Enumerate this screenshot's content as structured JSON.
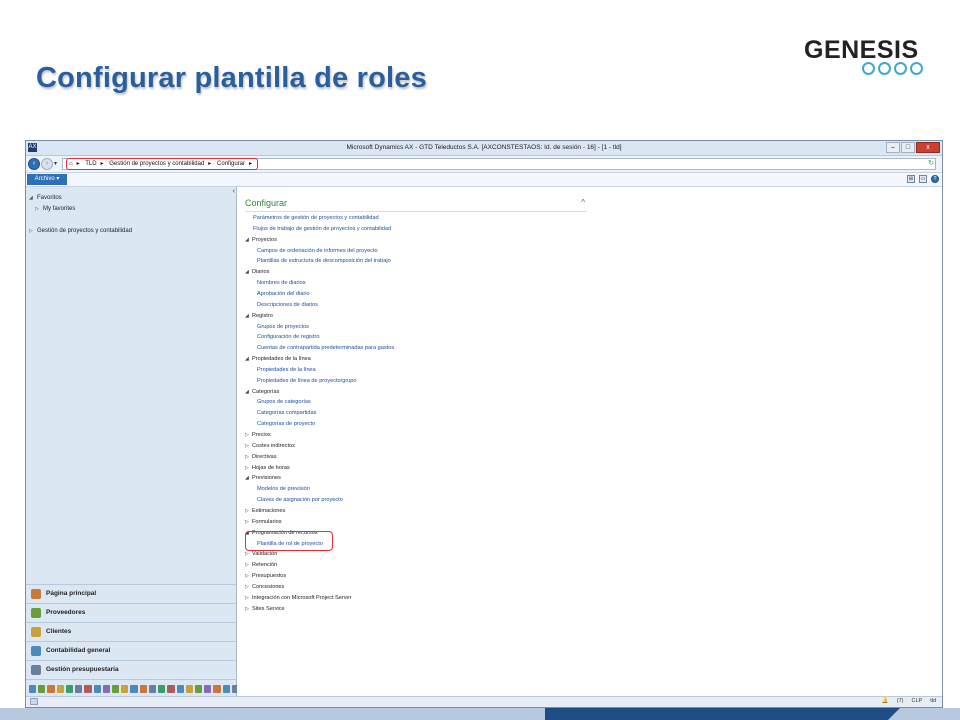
{
  "slide": {
    "title": "Configurar plantilla de roles",
    "logo_text": "GENESIS",
    "brand_color": "#2a5f9e",
    "ring_color": "#3fa7d6"
  },
  "window": {
    "title": "Microsoft Dynamics AX - GTD Teleductos S.A. [AXCONSTESTAOS: Id. de sesión - 16] - [1 - tld]",
    "app_icon": "AX",
    "controls": {
      "minimize": "–",
      "restore": "□",
      "close": "x"
    }
  },
  "address": {
    "crumbs": [
      "TLD",
      "Gestión de proyectos y contabilidad",
      "Configurar"
    ],
    "highlight_color": "#d33333"
  },
  "menu": {
    "archivo": "Archivo ▾"
  },
  "navpane": {
    "collapse": "‹",
    "items": [
      {
        "label": "Favoritos",
        "expanded": true
      },
      {
        "label": "My favorites",
        "expanded": false
      },
      {
        "label": "Gestión de proyectos y contabilidad",
        "expanded": false
      }
    ],
    "modules": [
      {
        "label": "Página principal",
        "color": "#c7783a"
      },
      {
        "label": "Proveedores",
        "color": "#6a9c3a"
      },
      {
        "label": "Clientes",
        "color": "#c8a13a"
      },
      {
        "label": "Contabilidad general",
        "color": "#4a8bbd"
      },
      {
        "label": "Gestión presupuestaria",
        "color": "#6b7f9c"
      }
    ]
  },
  "content": {
    "group_title": "Configurar",
    "collapse_caret": "^",
    "rows": [
      {
        "type": "link",
        "indent": 0,
        "label": "Parámetros de gestión de proyectos y contabilidad"
      },
      {
        "type": "link",
        "indent": 0,
        "label": "Flujos de trabajo de gestión de proyectos y contabilidad"
      },
      {
        "type": "cat",
        "expanded": true,
        "label": "Proyectos"
      },
      {
        "type": "link",
        "indent": 1,
        "label": "Campos de ordenación de informes del proyecto"
      },
      {
        "type": "link",
        "indent": 1,
        "label": "Plantillas de estructura de descomposición del trabajo"
      },
      {
        "type": "cat",
        "expanded": true,
        "label": "Diarios"
      },
      {
        "type": "link",
        "indent": 1,
        "label": "Nombres de diarios"
      },
      {
        "type": "link",
        "indent": 1,
        "label": "Aprobación del diario"
      },
      {
        "type": "link",
        "indent": 1,
        "label": "Descripciones de diarios"
      },
      {
        "type": "cat",
        "expanded": true,
        "label": "Registro"
      },
      {
        "type": "link",
        "indent": 1,
        "label": "Grupos de proyectos"
      },
      {
        "type": "link",
        "indent": 1,
        "label": "Configuración de registro"
      },
      {
        "type": "link",
        "indent": 1,
        "label": "Cuentas de contrapartida predeterminadas para gastos"
      },
      {
        "type": "cat",
        "expanded": true,
        "label": "Propiedades de la línea"
      },
      {
        "type": "link",
        "indent": 1,
        "label": "Propiedades de la línea"
      },
      {
        "type": "link",
        "indent": 1,
        "label": "Propiedades de línea de proyecto/grupo"
      },
      {
        "type": "cat",
        "expanded": true,
        "label": "Categorías"
      },
      {
        "type": "link",
        "indent": 1,
        "label": "Grupos de categorías"
      },
      {
        "type": "link",
        "indent": 1,
        "label": "Categorías compartidas"
      },
      {
        "type": "link",
        "indent": 1,
        "label": "Categorías de proyecto"
      },
      {
        "type": "cat",
        "expanded": false,
        "label": "Precios"
      },
      {
        "type": "cat",
        "expanded": false,
        "label": "Costes indirectos"
      },
      {
        "type": "cat",
        "expanded": false,
        "label": "Directivas"
      },
      {
        "type": "cat",
        "expanded": false,
        "label": "Hojas de horas"
      },
      {
        "type": "cat",
        "expanded": true,
        "label": "Previsiones"
      },
      {
        "type": "link",
        "indent": 1,
        "label": "Modelos de previsión"
      },
      {
        "type": "link",
        "indent": 1,
        "label": "Claves de asignación por proyecto"
      },
      {
        "type": "cat",
        "expanded": false,
        "label": "Estimaciones"
      },
      {
        "type": "cat",
        "expanded": false,
        "label": "Formularios"
      },
      {
        "type": "cat",
        "expanded": true,
        "label": "Programación de recursos"
      },
      {
        "type": "link",
        "indent": 1,
        "label": "Plantilla de rol de proyecto"
      },
      {
        "type": "cat",
        "expanded": false,
        "label": "Validación"
      },
      {
        "type": "cat",
        "expanded": false,
        "label": "Retención"
      },
      {
        "type": "cat",
        "expanded": false,
        "label": "Presupuestos"
      },
      {
        "type": "cat",
        "expanded": false,
        "label": "Concesiones"
      },
      {
        "type": "cat",
        "expanded": false,
        "label": "Integración con Microsoft Project Server"
      },
      {
        "type": "cat",
        "expanded": false,
        "label": "Sites Service"
      }
    ]
  },
  "status": {
    "notifications": "(7)",
    "currency": "CLP",
    "company": "tld"
  }
}
